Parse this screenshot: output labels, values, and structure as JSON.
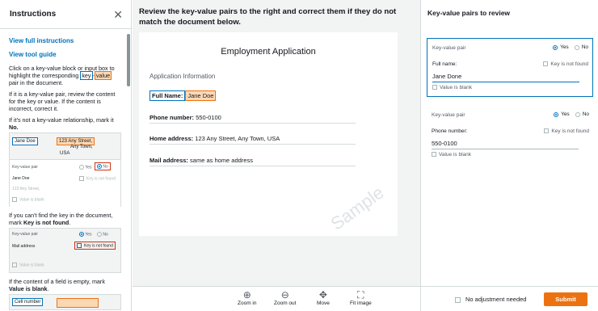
{
  "left": {
    "title": "Instructions",
    "links": [
      "View full instructions",
      "View tool guide"
    ],
    "p1_a": "Click on a key-value block or input box to highlight the corresponding ",
    "p1_key": "key",
    "p1_dash": "-",
    "p1_value": "value",
    "p1_b": " pair in the document.",
    "p2": "If it is a key-value pair, review the content for the key or value. If the content is incorrect, correct it.",
    "p3_a": "If it's not a key-value relationship, mark it ",
    "p3_b": "No.",
    "ex1": {
      "key": "Jane Doe",
      "value_lines": [
        "123 Any Street,",
        "Any Town,",
        "USA"
      ],
      "kv": "Key-value pair",
      "yes": "Yes",
      "no": "No",
      "name": "Jane Doe",
      "knf": "Key is not found",
      "addr": "123 Any Street,",
      "blank": "Value is blank"
    },
    "p4_a": "If you can't find the key in the document, mark ",
    "p4_b": "Key is not found",
    "p4_c": ".",
    "ex2": {
      "kv": "Key-value pair",
      "yes": "Yes",
      "no": "No",
      "field": "Mail address",
      "knf": "Key is not found",
      "blank": "Value is blank"
    },
    "p5_a": "If the content of a field is empty, mark ",
    "p5_b": "Value is blank",
    "p5_c": ".",
    "ex3": {
      "key": "Cell number"
    }
  },
  "mid": {
    "instruction": "Review the key-value pairs to the right and correct them if they do not match the document below.",
    "doc_title": "Employment Application",
    "section": "Application Information",
    "full_name_key": "Full Name:",
    "full_name_val": "Jane Doe",
    "phone_key": "Phone number:",
    "phone_val": " 550-0100",
    "home_key": "Home address:",
    "home_val": " 123 Any Street, Any Town, USA",
    "mail_key": "Mail address:",
    "mail_val": " same as home address",
    "watermark": "Sample",
    "tools": [
      "Zoom in",
      "Zoom out",
      "Move",
      "Fit image"
    ]
  },
  "right": {
    "title": "Key-value pairs to review",
    "cards": [
      {
        "kv": "Key-value pair",
        "yes": "Yes",
        "no": "No",
        "field": "Full name:",
        "knf": "Key is not found",
        "value": "Jane Done",
        "blank": "Value is blank"
      },
      {
        "kv": "Key-value pair",
        "yes": "Yes",
        "no": "No",
        "field": "Phone number:",
        "knf": "Key is not found",
        "value": "550-0100",
        "blank": "Value is blank"
      }
    ],
    "no_adjust": "No adjustment needed",
    "submit": "Submit"
  }
}
